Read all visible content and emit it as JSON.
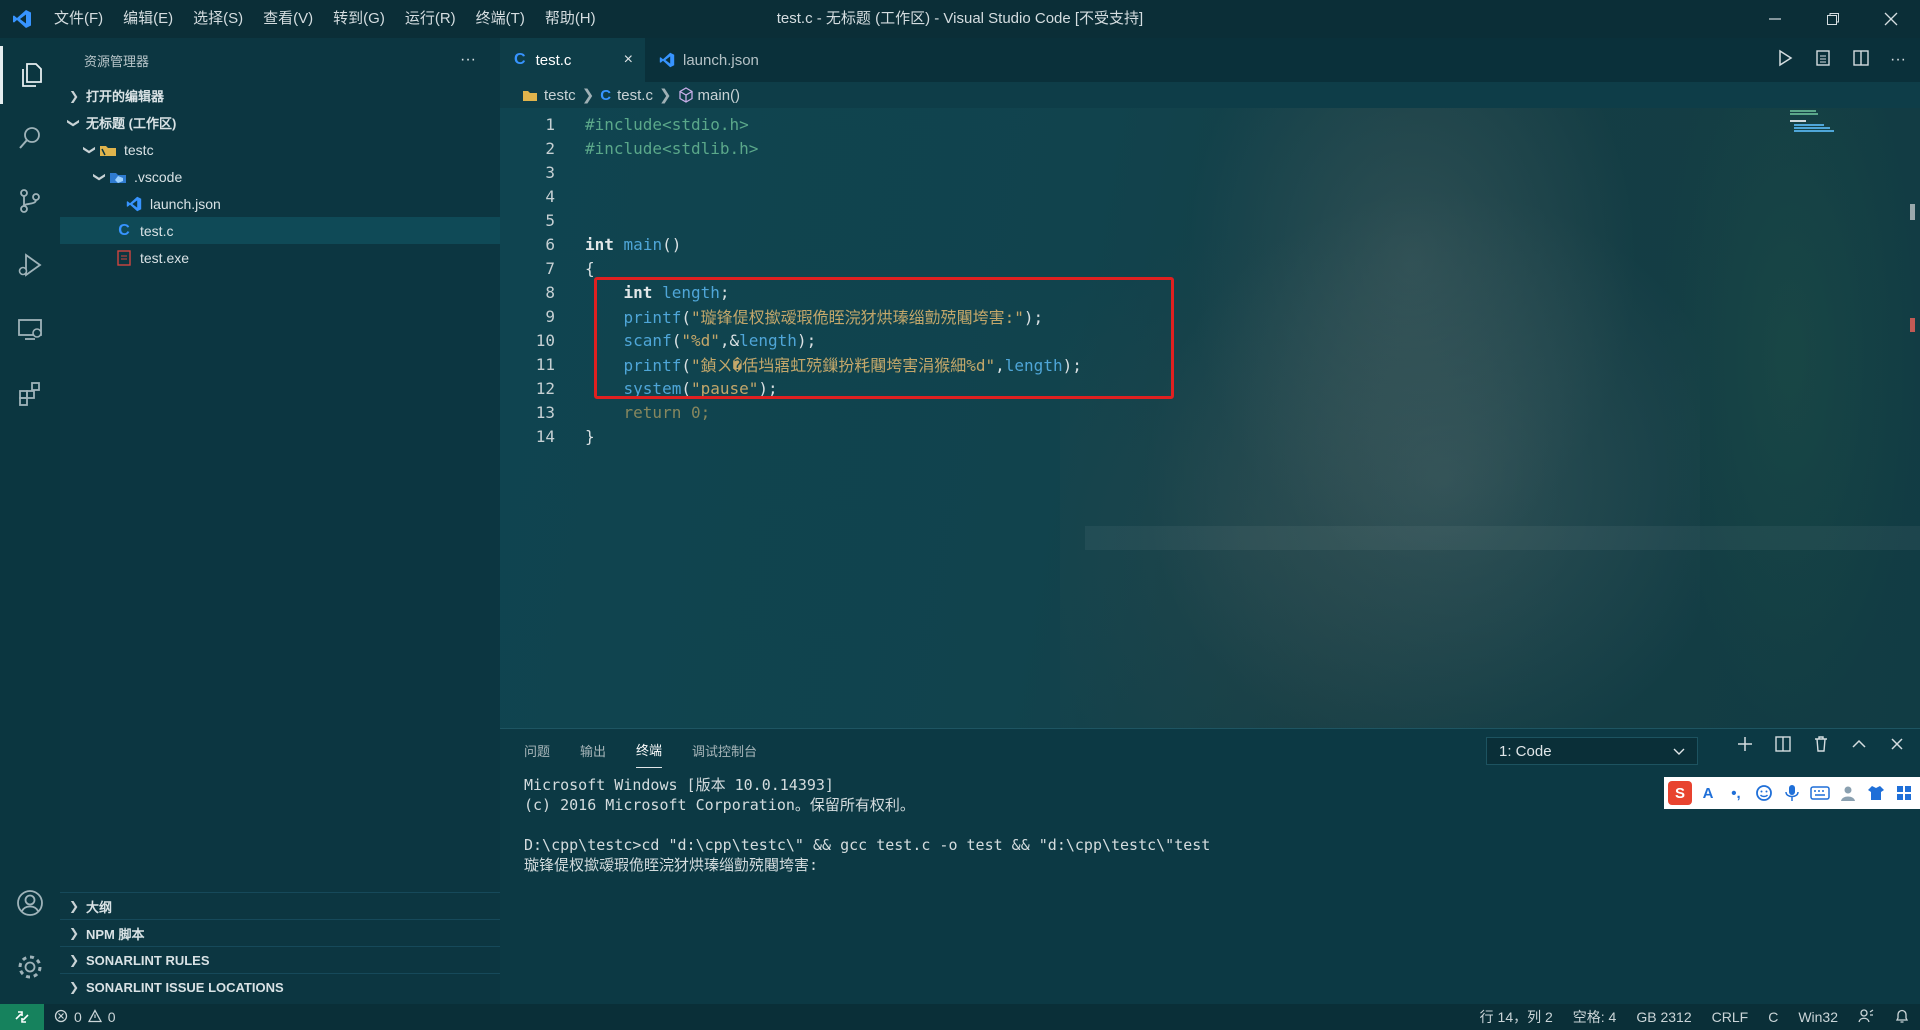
{
  "window": {
    "title": "test.c - 无标题 (工作区) - Visual Studio Code [不受支持]",
    "menus": [
      "文件(F)",
      "编辑(E)",
      "选择(S)",
      "查看(V)",
      "转到(G)",
      "运行(R)",
      "终端(T)",
      "帮助(H)"
    ]
  },
  "sidebar": {
    "title": "资源管理器",
    "more": "···",
    "open_editors": "打开的编辑器",
    "workspace": "无标题 (工作区)",
    "tree": {
      "folder": "testc",
      "subfolder": ".vscode",
      "launch": "launch.json",
      "testc_file": "test.c",
      "testexe": "test.exe"
    },
    "sections": {
      "outline": "大纲",
      "npm": "NPM 脚本",
      "sonar_rules": "SONARLINT RULES",
      "sonar_issues": "SONARLINT ISSUE LOCATIONS"
    }
  },
  "tabs": {
    "active": "test.c",
    "inactive": "launch.json",
    "close": "×"
  },
  "breadcrumb": {
    "folder": "testc",
    "file": "test.c",
    "symbol": "main()"
  },
  "code": {
    "lines": [
      "1",
      "2",
      "3",
      "4",
      "5",
      "6",
      "7",
      "8",
      "9",
      "10",
      "11",
      "12",
      "13",
      "14"
    ],
    "l1a": "#include",
    "l1b": "<stdio.h>",
    "l2a": "#include",
    "l2b": "<stdlib.h>",
    "l6a": "int",
    "l6b": "main",
    "l6c": "()",
    "l7": "{",
    "l8a": "int",
    "l8b": "length",
    "l8c": ";",
    "l9a": "printf",
    "l9b": "(",
    "l9c": "\"璇锋偍杈撳叆瑕佹眰浣犲烘瑧缁勯殑闀垮害:\"",
    "l9d": ");",
    "l10a": "scanf",
    "l10b": "(",
    "l10c": "\"%d\"",
    "l10d": ",&",
    "l10e": "length",
    "l10f": ");",
    "l11a": "printf",
    "l11b": "(",
    "l11c": "\"鍞ㄨ�佸垱寤虹殑鏁扮粍闀垮害涓猴細%d\"",
    "l11d": ",",
    "l11e": "length",
    "l11f": ");",
    "l12a": "system",
    "l12b": "(",
    "l12c": "\"pause\"",
    "l12d": ");",
    "l13a": "return",
    "l13b": "0",
    "l13c": ";",
    "l14": "}"
  },
  "panel": {
    "tabs": [
      "问题",
      "输出",
      "终端",
      "调试控制台"
    ],
    "terminal_select": "1: Code",
    "terminal_lines": [
      "Microsoft Windows [版本 10.0.14393]",
      "(c) 2016 Microsoft Corporation。保留所有权利。",
      "",
      "D:\\cpp\\testc>cd \"d:\\cpp\\testc\\\" && gcc test.c -o test && \"d:\\cpp\\testc\\\"test",
      "璇锋偍杈撳叆瑕佹眰浣犲烘瑧缁勯殑闀垮害:"
    ],
    "ime_letter": "S",
    "ime_a": "A",
    "ime_punct": "•,"
  },
  "status": {
    "errors": "0",
    "warnings": "0",
    "position": "行 14，列 2",
    "spaces": "空格: 4",
    "encoding": "GB 2312",
    "eol": "CRLF",
    "language": "C",
    "platform": "Win32"
  },
  "colors": {
    "accent": "#3794ff",
    "redbox": "#e02020",
    "remote": "#16825d"
  }
}
